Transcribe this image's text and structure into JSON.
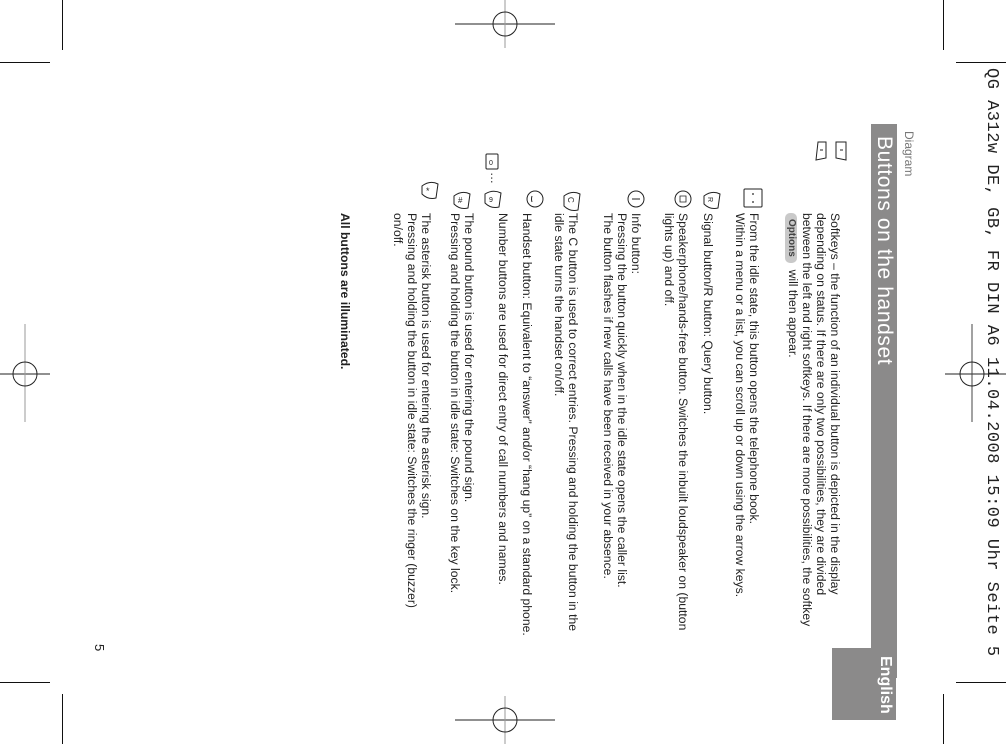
{
  "slug": "QG A312w DE, GB, FR DIN A6  11.04.2008  15:09 Uhr  Seite 5",
  "section_label": "Diagram",
  "title": "Buttons on the handset",
  "language_tab": "English",
  "page_number": "5",
  "colors": {
    "title_bar": "#8b8a8a",
    "tab": "#8b8a8a",
    "options_badge": "#c9c9c9"
  },
  "entries": [
    {
      "icon": "softkeys-icon",
      "lines": [
        "Softkeys – the function of an individual button is depicted in the display",
        "depending on status. If there are only two possibilities, they are divided",
        "between the left and right softkeys. If there are more possibilities, the softkey"
      ],
      "badge": "Options",
      "badge_suffix": "will then appear."
    },
    {
      "icon": "navigation-key-icon",
      "lines": [
        "From the idle state, this button opens the telephone book.",
        "Within a menu or a list, you can scroll up or down using the arrow keys."
      ]
    },
    {
      "icon": "signal-r-button-icon",
      "lines": [
        "Signal button/R button: Query button."
      ]
    },
    {
      "icon": "speakerphone-icon",
      "lines": [
        "Speakerphone/hands-free button. Switches the inbuilt loudspeaker on (button",
        "lights up) and off."
      ]
    },
    {
      "icon": "info-button-icon",
      "lines": [
        "Info button:",
        "Pressing the button quickly when in the idle state opens the caller list.",
        "The button flashes if new calls have been received in your absence."
      ]
    },
    {
      "icon": "c-button-icon",
      "lines": [
        "The C button is used to correct entries. Pressing and holding the button in the",
        "idle state turns the handset on/off."
      ]
    },
    {
      "icon": "handset-button-icon",
      "lines": [
        "Handset button: Equivalent to “answer” and/or “hang up” on a standard phone."
      ]
    },
    {
      "icon": "number-buttons-icon",
      "icon_label": "0 … 9",
      "lines": [
        "Number buttons are used for direct entry of call numbers and names."
      ]
    },
    {
      "icon": "pound-button-icon",
      "lines": [
        "The pound button is used for entering the pound sign.",
        "Pressing and holding the button in idle state: Switches on the key lock."
      ]
    },
    {
      "icon": "asterisk-button-icon",
      "lines": [
        "The asterisk button is used for entering the asterisk sign.",
        "Pressing and holding the button in idle state: Switches the ringer (buzzer)",
        "on/off."
      ]
    }
  ],
  "footer_note": "All buttons are illuminated.",
  "icon_glyphs": {
    "ellipsis": "…",
    "zero": "0",
    "nine": "9",
    "pound": "#",
    "asterisk": "*",
    "c": "C",
    "r": "R"
  }
}
